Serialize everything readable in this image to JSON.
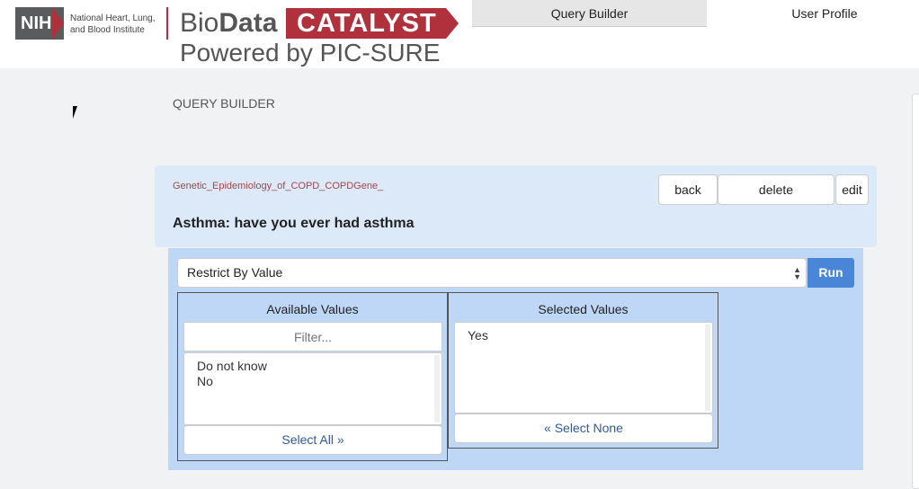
{
  "header": {
    "nih_logo": "NIH",
    "nih_text_line1": "National Heart, Lung,",
    "nih_text_line2": "and Blood Institute",
    "brand_bio": "Bio",
    "brand_data": "Data",
    "brand_catalyst": "CATALYST",
    "brand_powered": "Powered by PIC-SURE",
    "brand_color": "#b0303b",
    "tabs": [
      {
        "label": "Query Builder",
        "active": true
      },
      {
        "label": "User Profile",
        "active": false
      }
    ]
  },
  "main": {
    "page_title": "QUERY BUILDER",
    "panel": {
      "study": "Genetic_Epidemiology_of_COPD_COPDGene_",
      "concept": "Asthma: have you ever had asthma",
      "back_label": "back",
      "delete_label": "delete",
      "edit_label": "edit"
    },
    "restrict": {
      "select_value": "Restrict By Value",
      "run_label": "Run",
      "available": {
        "title": "Available Values",
        "filter_placeholder": "Filter...",
        "items": [
          "Do not know",
          "No"
        ],
        "select_all_label": "Select All »"
      },
      "selected": {
        "title": "Selected Values",
        "items": [
          "Yes"
        ],
        "select_none_label": "« Select None"
      }
    }
  }
}
